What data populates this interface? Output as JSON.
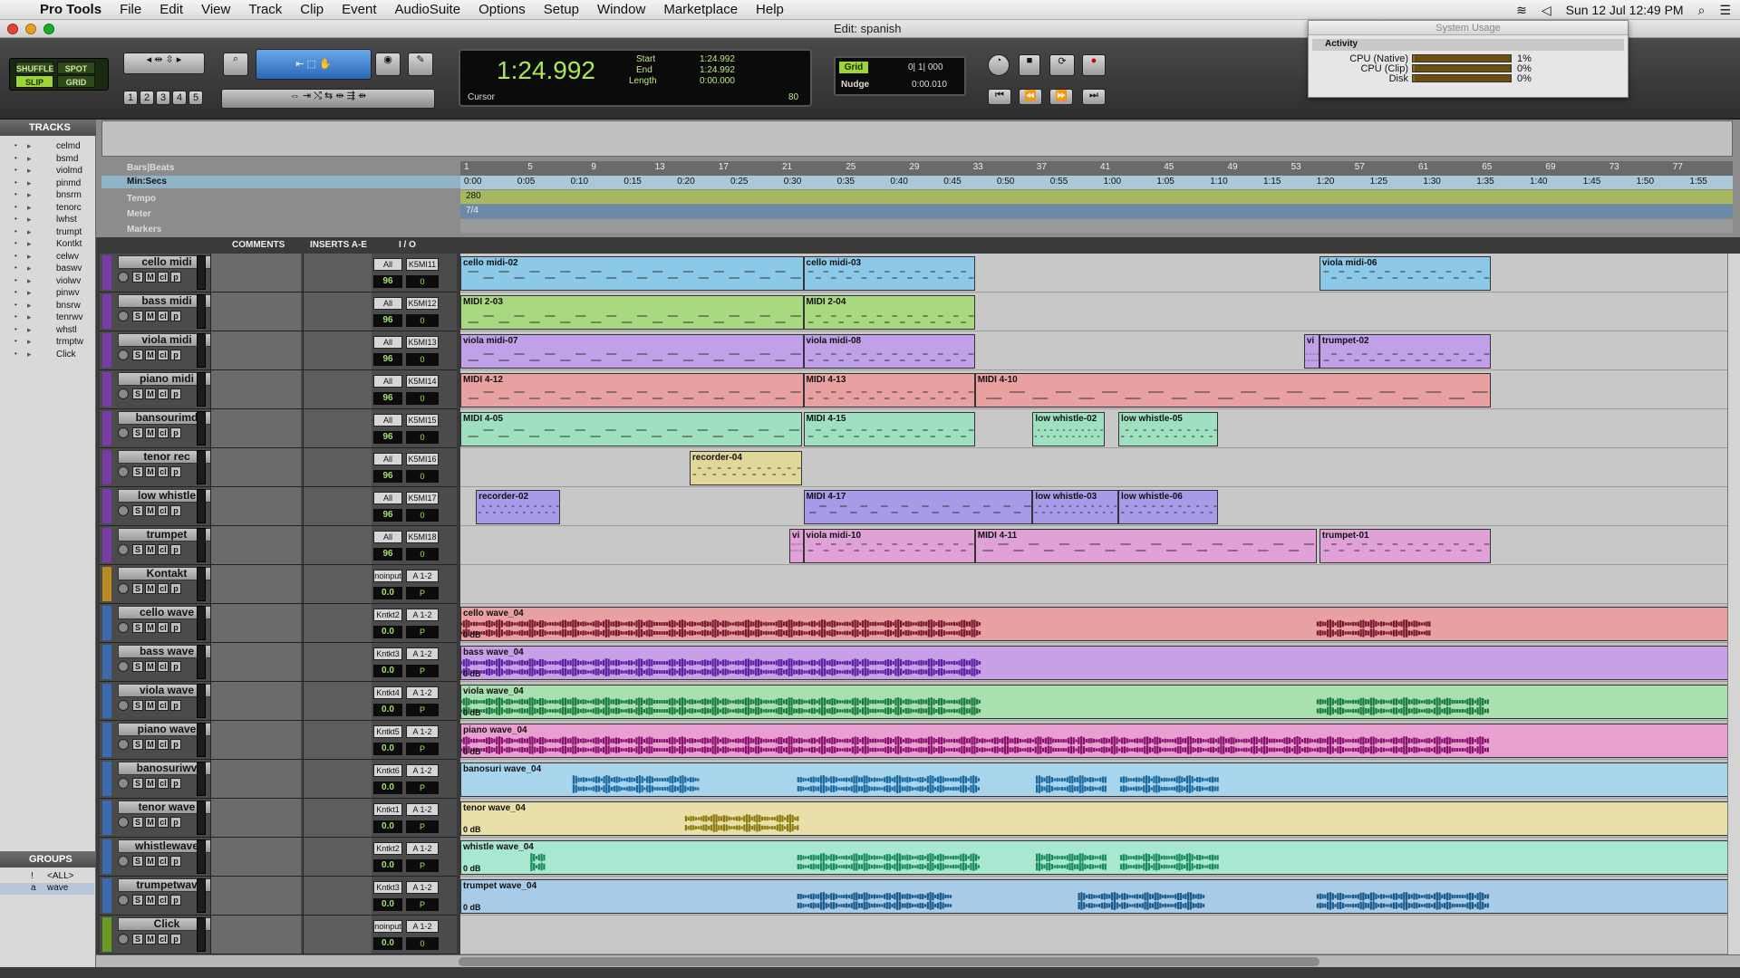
{
  "menubar": {
    "app": "Pro Tools",
    "items": [
      "File",
      "Edit",
      "View",
      "Track",
      "Clip",
      "Event",
      "AudioSuite",
      "Options",
      "Setup",
      "Window",
      "Marketplace",
      "Help"
    ],
    "clock": "Sun 12 Jul  12:49 PM"
  },
  "window": {
    "title": "Edit: spanish"
  },
  "toolbar": {
    "modes": {
      "shuffle": "SHUFFLE",
      "spot": "SPOT",
      "slip": "SLIP",
      "grid": "GRID"
    },
    "zoom_presets": [
      "1",
      "2",
      "3",
      "4",
      "5"
    ],
    "counter": {
      "main": "1:24.992",
      "start_label": "Start",
      "start": "1:24.992",
      "end_label": "End",
      "end": "1:24.992",
      "length_label": "Length",
      "length": "0:00.000",
      "cursor_label": "Cursor",
      "tempo": "80"
    },
    "grid": {
      "label": "Grid",
      "value": "0| 1| 000"
    },
    "nudge": {
      "label": "Nudge",
      "value": "0:00.010"
    }
  },
  "system_usage": {
    "title": "System Usage",
    "section": "Activity",
    "rows": [
      {
        "label": "CPU (Native)",
        "value": "1%",
        "fraction": 0.01
      },
      {
        "label": "CPU (Clip)",
        "value": "0%",
        "fraction": 0.0
      },
      {
        "label": "Disk",
        "value": "0%",
        "fraction": 0.0
      }
    ]
  },
  "tracks_panel": {
    "title": "TRACKS",
    "items": [
      "celmd",
      "bsmd",
      "violmd",
      "pinmd",
      "bnsrm",
      "tenorc",
      "lwhst",
      "trumpt",
      "Kontkt",
      "celwv",
      "baswv",
      "violwv",
      "pinwv",
      "bnsrw",
      "tenrwv",
      "whstl",
      "trmptw",
      "Click"
    ]
  },
  "groups_panel": {
    "title": "GROUPS",
    "items": [
      {
        "id": "!",
        "name": "<ALL>"
      },
      {
        "id": "a",
        "name": "wave"
      }
    ]
  },
  "rulers": {
    "bars_label": "Bars|Beats",
    "mins_label": "Min:Secs",
    "tempo_label": "Tempo",
    "meter_label": "Meter",
    "markers_label": "Markers",
    "tempo_value": "280",
    "meter_value": "7/4",
    "bars": [
      "1",
      "5",
      "9",
      "13",
      "17",
      "21",
      "25",
      "29",
      "33",
      "37",
      "41",
      "45",
      "49",
      "53",
      "57",
      "61",
      "65",
      "69",
      "73",
      "77"
    ],
    "secs": [
      "0:00",
      "0:05",
      "0:10",
      "0:15",
      "0:20",
      "0:25",
      "0:30",
      "0:35",
      "0:40",
      "0:45",
      "0:50",
      "0:55",
      "1:00",
      "1:05",
      "1:10",
      "1:15",
      "1:20",
      "1:25",
      "1:30",
      "1:35",
      "1:40",
      "1:45",
      "1:50",
      "1:55"
    ]
  },
  "columns": {
    "comments": "COMMENTS",
    "inserts": "INSERTS A-E",
    "io": "I / O"
  },
  "tracks": [
    {
      "name": "cello midi",
      "kind": "midi",
      "color": "#7a3aa8",
      "in": "All",
      "out": "K5MI11",
      "vol": "96",
      "pan": "0",
      "clips": [
        {
          "label": "cello midi-02",
          "start": 0,
          "end": 0.244,
          "color": "#8cc8e8"
        },
        {
          "label": "cello midi-03",
          "start": 0.244,
          "end": 0.366,
          "color": "#8cc8e8"
        },
        {
          "label": "viola midi-06",
          "start": 0.611,
          "end": 0.733,
          "color": "#8cc8e8"
        }
      ]
    },
    {
      "name": "bass midi",
      "kind": "midi",
      "color": "#7a3aa8",
      "in": "All",
      "out": "K5MI12",
      "vol": "96",
      "pan": "0",
      "clips": [
        {
          "label": "MIDI 2-03",
          "start": 0,
          "end": 0.244,
          "color": "#a8d880"
        },
        {
          "label": "MIDI 2-04",
          "start": 0.244,
          "end": 0.366,
          "color": "#a8d880"
        }
      ]
    },
    {
      "name": "viola midi",
      "kind": "midi",
      "color": "#7a3aa8",
      "in": "All",
      "out": "K5MI13",
      "vol": "96",
      "pan": "0",
      "clips": [
        {
          "label": "viola midi-07",
          "start": 0,
          "end": 0.244,
          "color": "#c0a0e8"
        },
        {
          "label": "viola midi-08",
          "start": 0.244,
          "end": 0.366,
          "color": "#c0a0e8"
        },
        {
          "label": "vi",
          "start": 0.6,
          "end": 0.611,
          "color": "#c0a0e8"
        },
        {
          "label": "trumpet-02",
          "start": 0.611,
          "end": 0.733,
          "color": "#c0a0e8"
        }
      ]
    },
    {
      "name": "piano midi",
      "kind": "midi",
      "color": "#7a3aa8",
      "in": "All",
      "out": "K5MI14",
      "vol": "96",
      "pan": "0",
      "clips": [
        {
          "label": "MIDI 4-12",
          "start": 0,
          "end": 0.244,
          "color": "#e8a0a0"
        },
        {
          "label": "MIDI 4-13",
          "start": 0.244,
          "end": 0.366,
          "color": "#e8a0a0"
        },
        {
          "label": "MIDI 4-10",
          "start": 0.366,
          "end": 0.733,
          "color": "#e8a0a0"
        }
      ]
    },
    {
      "name": "bansourimd",
      "kind": "midi",
      "color": "#7a3aa8",
      "in": "All",
      "out": "K5MI15",
      "vol": "96",
      "pan": "0",
      "clips": [
        {
          "label": "MIDI 4-05",
          "start": 0,
          "end": 0.243,
          "color": "#9ee0c0"
        },
        {
          "label": "MIDI 4-15",
          "start": 0.244,
          "end": 0.366,
          "color": "#9ee0c0"
        },
        {
          "label": "low whistle-02",
          "start": 0.407,
          "end": 0.458,
          "color": "#9ee0c0"
        },
        {
          "label": "low whistle-05",
          "start": 0.468,
          "end": 0.539,
          "color": "#9ee0c0"
        }
      ]
    },
    {
      "name": "tenor rec",
      "kind": "midi",
      "color": "#7a3aa8",
      "in": "All",
      "out": "K5MI16",
      "vol": "96",
      "pan": "0",
      "clips": [
        {
          "label": "recorder-04",
          "start": 0.163,
          "end": 0.243,
          "color": "#e0d898"
        }
      ]
    },
    {
      "name": "low whistle",
      "kind": "midi",
      "color": "#7a3aa8",
      "in": "All",
      "out": "K5MI17",
      "vol": "96",
      "pan": "0",
      "clips": [
        {
          "label": "recorder-02",
          "start": 0.011,
          "end": 0.071,
          "color": "#a89ae8"
        },
        {
          "label": "MIDI 4-17",
          "start": 0.244,
          "end": 0.407,
          "color": "#a89ae8"
        },
        {
          "label": "low whistle-03",
          "start": 0.407,
          "end": 0.468,
          "color": "#a89ae8"
        },
        {
          "label": "low whistle-06",
          "start": 0.468,
          "end": 0.539,
          "color": "#a89ae8"
        }
      ]
    },
    {
      "name": "trumpet",
      "kind": "midi",
      "color": "#7a3aa8",
      "in": "All",
      "out": "K5MI18",
      "vol": "96",
      "pan": "0",
      "clips": [
        {
          "label": "vi",
          "start": 0.234,
          "end": 0.244,
          "color": "#e0a0d8"
        },
        {
          "label": "viola midi-10",
          "start": 0.244,
          "end": 0.366,
          "color": "#e0a0d8"
        },
        {
          "label": "MIDI 4-11",
          "start": 0.366,
          "end": 0.609,
          "color": "#e0a0d8"
        },
        {
          "label": "trumpet-01",
          "start": 0.611,
          "end": 0.733,
          "color": "#e0a0d8"
        }
      ]
    },
    {
      "name": "Kontakt",
      "kind": "inst",
      "color": "#b88a20",
      "in": "noinput",
      "out": "A 1-2",
      "vol": "0.0",
      "pan": "P",
      "clips": []
    },
    {
      "name": "cello wave",
      "kind": "audio",
      "color": "#3a6ab0",
      "in": "Kntkt2",
      "out": "A 1-2",
      "vol": "0.0",
      "pan": "P",
      "lane_color": "#e8a0a0",
      "wave_color": "#7a1830",
      "clips": [
        {
          "label": "cello wave_04",
          "start": 0,
          "end": 1.0,
          "color": "#e8a0a0",
          "db": "0 dB"
        }
      ]
    },
    {
      "name": "bass wave",
      "kind": "audio",
      "color": "#3a6ab0",
      "in": "Kntkt3",
      "out": "A 1-2",
      "vol": "0.0",
      "pan": "P",
      "clips": [
        {
          "label": "bass wave_04",
          "start": 0,
          "end": 1.0,
          "color": "#c8a0e8",
          "db": "0 dB"
        }
      ]
    },
    {
      "name": "viola wave",
      "kind": "audio",
      "color": "#3a6ab0",
      "in": "Kntkt4",
      "out": "A 1-2",
      "vol": "0.0",
      "pan": "P",
      "clips": [
        {
          "label": "viola wave_04",
          "start": 0,
          "end": 1.0,
          "color": "#a8e0b0",
          "db": "0 dB"
        }
      ]
    },
    {
      "name": "piano wave",
      "kind": "audio",
      "color": "#3a6ab0",
      "in": "Kntkt5",
      "out": "A 1-2",
      "vol": "0.0",
      "pan": "P",
      "clips": [
        {
          "label": "piano wave_04",
          "start": 0,
          "end": 1.0,
          "color": "#e8a0d0",
          "db": "0 dB"
        }
      ]
    },
    {
      "name": "banosuriwv",
      "kind": "audio",
      "color": "#3a6ab0",
      "in": "Kntkt6",
      "out": "A 1-2",
      "vol": "0.0",
      "pan": "P",
      "clips": [
        {
          "label": "banosuri wave_04",
          "start": 0,
          "end": 1.0,
          "color": "#a8d4ec",
          "db": ""
        }
      ]
    },
    {
      "name": "tenor wave",
      "kind": "audio",
      "color": "#3a6ab0",
      "in": "Kntkt1",
      "out": "A 1-2",
      "vol": "0.0",
      "pan": "P",
      "clips": [
        {
          "label": "tenor wave_04",
          "start": 0,
          "end": 1.0,
          "color": "#e8e0a8",
          "db": "0 dB"
        }
      ]
    },
    {
      "name": "whistlewave",
      "kind": "audio",
      "color": "#3a6ab0",
      "in": "Kntkt2",
      "out": "A 1-2",
      "vol": "0.0",
      "pan": "P",
      "clips": [
        {
          "label": "whistle wave_04",
          "start": 0,
          "end": 1.0,
          "color": "#a8e8d0",
          "db": "0 dB"
        }
      ]
    },
    {
      "name": "trumpetwav",
      "kind": "audio",
      "color": "#3a6ab0",
      "in": "Kntkt3",
      "out": "A 1-2",
      "vol": "0.0",
      "pan": "P",
      "clips": [
        {
          "label": "trumpet wave_04",
          "start": 0,
          "end": 1.0,
          "color": "#a8cce8",
          "db": "0 dB"
        }
      ]
    },
    {
      "name": "Click",
      "kind": "inst",
      "color": "#6a9a20",
      "in": "noinput",
      "out": "A 1-2",
      "vol": "0.0",
      "pan": "0",
      "clips": []
    }
  ],
  "waveform_colors": [
    "#7a1830",
    "#5a20a0",
    "#1a7a40",
    "#8a1070",
    "#1a6aa0",
    "#8a7a10",
    "#1a8a60",
    "#1a5a8a"
  ],
  "waveform_active_ranges": [
    [
      [
        0,
        0.37
      ],
      [
        0.61,
        0.69
      ]
    ],
    [
      [
        0,
        0.37
      ]
    ],
    [
      [
        0,
        0.37
      ],
      [
        0.61,
        0.733
      ]
    ],
    [
      [
        0,
        0.733
      ]
    ],
    [
      [
        0.08,
        0.17
      ],
      [
        0.24,
        0.37
      ],
      [
        0.41,
        0.46
      ],
      [
        0.47,
        0.54
      ]
    ],
    [
      [
        0.16,
        0.24
      ]
    ],
    [
      [
        0.05,
        0.06
      ],
      [
        0.24,
        0.37
      ],
      [
        0.41,
        0.46
      ],
      [
        0.47,
        0.54
      ]
    ],
    [
      [
        0.24,
        0.35
      ],
      [
        0.44,
        0.53
      ],
      [
        0.61,
        0.733
      ]
    ]
  ]
}
